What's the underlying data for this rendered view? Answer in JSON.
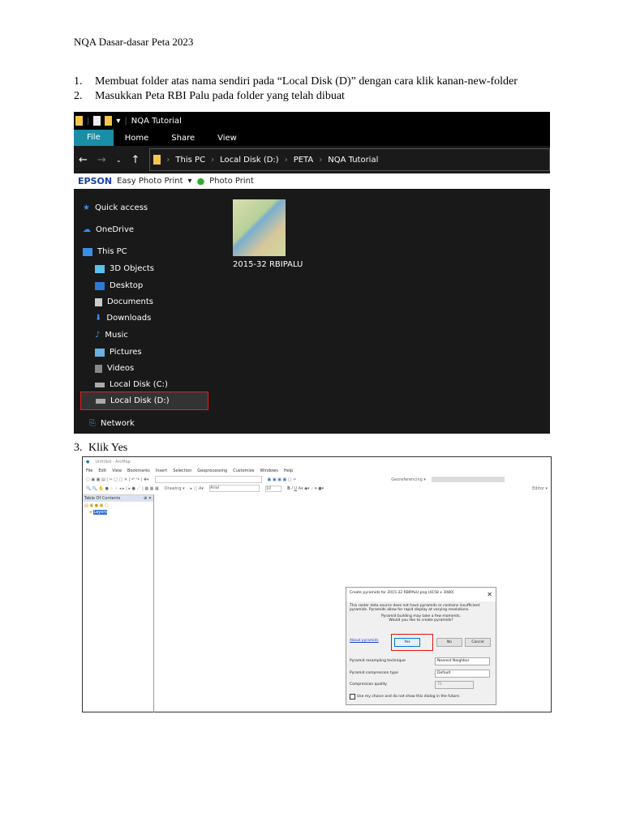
{
  "header": "NQA Dasar-dasar Peta 2023",
  "steps": [
    {
      "num": "1.",
      "text": "Membuat folder atas nama sendiri pada “Local Disk (D)” dengan cara klik kanan-new-folder"
    },
    {
      "num": "2.",
      "text": "Masukkan Peta RBI Palu pada folder yang telah dibuat"
    },
    {
      "num": "3.",
      "text": "Klik Yes"
    }
  ],
  "explorer": {
    "title": "NQA Tutorial",
    "tabs": [
      "File",
      "Home",
      "Share",
      "View"
    ],
    "breadcrumb": [
      "This PC",
      "Local Disk (D:)",
      "PETA",
      "NQA Tutorial"
    ],
    "epson": {
      "brand": "EPSON",
      "app": "Easy Photo Print",
      "print": "Photo Print"
    },
    "nav": [
      "Quick access",
      "OneDrive",
      "This PC",
      "3D Objects",
      "Desktop",
      "Documents",
      "Downloads",
      "Music",
      "Pictures",
      "Videos",
      "Local Disk (C:)",
      "Local Disk (D:)",
      "Network"
    ],
    "file": "2015-32 RBIPALU"
  },
  "arcmap": {
    "title": "Untitled - ArcMap",
    "menu": [
      "File",
      "Edit",
      "View",
      "Bookmarks",
      "Insert",
      "Selection",
      "Geoprocessing",
      "Customize",
      "Windows",
      "Help"
    ],
    "georef": "Georeferencing ▾",
    "drawing": "Drawing ▾",
    "font": "Arial",
    "size": "10",
    "editor": "Editor ▾",
    "toc_title": "Table Of Contents",
    "layers": "Layers"
  },
  "dialog": {
    "title": "Create pyramids for 2015-32 RBIPALU.png (4158 x 3080)",
    "msg1": "This raster data source does not have pyramids or contains insufficient pyramids. Pyramids allow for rapid display at varying resolutions.",
    "msg2": "Pyramid building may take a few moments.",
    "msg3": "Would you like to create pyramids?",
    "link": "About pyramids",
    "yes": "Yes",
    "no": "No",
    "cancel": "Cancel",
    "resampling_label": "Pyramid resampling technique",
    "resampling": "Nearest Neighbor",
    "compression_label": "Pyramid compression type",
    "compression": "Default",
    "quality_label": "Compression quality",
    "quality": "75",
    "checkbox": "Use my choice and do not show this dialog in the future."
  }
}
